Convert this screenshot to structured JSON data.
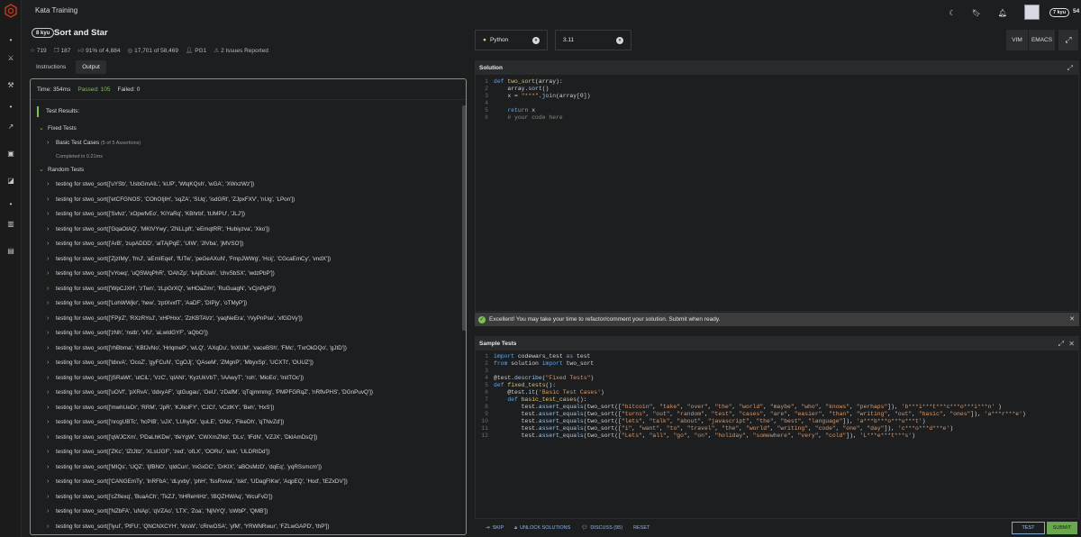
{
  "app": {
    "title": "Kata Training",
    "rank_badge": "7 kyu",
    "honor": "54"
  },
  "kata": {
    "kyu": "8 kyu",
    "title": "Sort and Star",
    "stats": {
      "stars": "719",
      "bookmarks": "187",
      "satisfaction": "91% of 4,884",
      "completions": "17,701 of 58,469",
      "author": "PG1",
      "issues": "2 Issues Reported"
    }
  },
  "tabs": {
    "instructions": "Instructions",
    "output": "Output"
  },
  "output": {
    "time": "Time: 354ms",
    "passed": "Passed: 105",
    "failed": "Failed: 0",
    "results_title": "Test Results:",
    "fixed_tests": "Fixed Tests",
    "basic_cases": "Basic Test Cases",
    "basic_cases_count": "(5 of 5 Assertions)",
    "completed": "Completed in 0.21ms",
    "random_tests": "Random Tests",
    "random_rows": [
      "testing for stwo_sort(['uYSb', 'UsbGmAIL', 'kUP', 'WtqKQsh', 'wGA', 'XWxzWz'])",
      "testing for stwo_sort(['etCFGNOS', 'COhOIjIH', 'sqZA', 'SUq', 'isdGRl', 'ZJpxFXV', 'nUg', 'LPon'])",
      "testing for stwo_sort(['Svlvz', 'xOpwfvEo', 'KIYaRq', 'KBhrbl', 'tUMPU', 'JLJ'])",
      "testing for stwo_sort(['GqaOtAQ', 'MKtVYwy', 'ZNLLpft', 'eEmqtRR', 'Hubiyzva', 'Xko'])",
      "testing for stwo_sort(['ArB', 'zupADDD', 'alTAjPqE', 'UIW', 'JIVba', 'jMVSO'])",
      "testing for stwo_sort(['ZjzIMy', 'fmJ', 'aEmIEqel', 'fUTw', 'peGeAXuN', 'FmpJWWg', 'Hcij', 'CGcaEmCy', 'vndX'])",
      "testing for stwo_sort(['vYoeq', 'uQSWqPhR', 'OAhZp', 'kAjlDUah', 'chvSbSX', 'wdzPbP'])",
      "testing for stwo_sort(['WpCJXH', 'zTwn', 'zLpGrXQ', 'wHOaZmr', 'RuGuagN', 'vCjnPpP'])",
      "testing for stwo_sort(['LohWWjkr', 'hew', 'zptXvxfT', 'AaDF', 'DIPjy', 'oTMyP'])",
      "testing for stwo_sort(['FPjrZ', 'RXzRYoJ', 'xHPHxx', 'ZzKBTAVz', 'yaqNeEra', 'rVyPnPse', 'xfGDVy'])",
      "testing for stwo_sort(['zNh', 'nstb', 'vfU', 'aLwldGYF', 'aQbO'])",
      "testing for stwo_sort(['rhBbma', 'KBfJvNo', 'HrlqmeP', 'wLQ', 'AXqDu', 'lnXUM', 'vaceBSh', 'FMc', 'TxrOkDQo', 'gJtD'])",
      "testing for stwo_sort(['ldxvA', 'OcoZ', 'gyFCuN', 'CgOJj', 'QAseM', 'ZMgnP', 'MbyxSp', 'UCXTt', 'OUUZ'])",
      "testing for stwo_sort(['jSRaWt', 'utCiL', 'VzC', 'qlANI', 'KyzUkVbT', 'IAAwyT', 'roh', 'MioEo', 'lnitTOc'])",
      "testing for stwo_sort(['uOVf', 'pXRvA', 'ddxyAF', 'qtGugau', 'OeU', 'zDafM', 'qTqjmmmg', 'PMPFGRqZ', 'nRflvPHS', 'DGnPuvQ'])",
      "testing for stwo_sort(['mwhUeDr', 'RRM', 'JpR', 'KJIiolFY', 'CJCI', 'vCzlKY', 'Beh', 'HxS'])",
      "testing for stwo_sort(['nrcgUBTc', 'hcPIB', 'uJX', 'LUhyDI', 'quLE', 'ONs', 'FikeDh', 'qTNvZd'])",
      "testing for stwo_sort(['qWJCXm', 'PDaLhKDw', 'tfeYgW', 'CWXmZNd', 'DLs', 'lFdN', 'VZJX', 'DklAmDsQ'])",
      "testing for stwo_sort(['ZKc', 'lZtJtlz', 'XLstJGF', 'zed', 'ofLX', 'OORu', 'exk', 'ULDRIDd'])",
      "testing for stwo_sort(['MIQs', 'UQZ', 'IjfBNO', 'qldCun', 'mGxDC', 'DrKlX', 'aBOsMzD', 'dqEq', 'yqRSsmcm'])",
      "testing for stwo_sort(['CANGEmTy', 'lnRFbA', 'dLyvby', 'phH', 'fssRvwa', 'Iskt', 'UDagFIKw', 'AqpEQ', 'Hod', 'tEZxDV'])",
      "testing for stwo_sort(['cZfIexq', 'BuaACh', 'TkZJ', 'hHReHiHz', 'IBQZHWAq', 'WcuFvD'])",
      "testing for stwo_sort(['NZbFA', 'uNAp', 'qVZAo', 'LTX', 'Zoa', 'NjNYQ', 'oWbP', 'QMB'])",
      "testing for stwo_sort(['lyuI', 'PtFU', 'QNCNXCYH', 'WsW', 'cRrwOSA', 'yfM', 'YRWNRwur', 'FZLwGAPD', 'thP'])"
    ]
  },
  "editor": {
    "language": "Python",
    "version": "3.11",
    "vim": "VIM",
    "emacs": "EMACS",
    "solution_title": "Solution",
    "sample_title": "Sample Tests"
  },
  "banner": "Excellent! You may take your time to refactor/comment your solution. Submit when ready.",
  "footer": {
    "skip": "SKIP",
    "unlock": "UNLOCK SOLUTIONS",
    "discuss": "DISCUSS (95)",
    "reset": "RESET",
    "test": "TEST",
    "submit": "SUBMIT"
  }
}
